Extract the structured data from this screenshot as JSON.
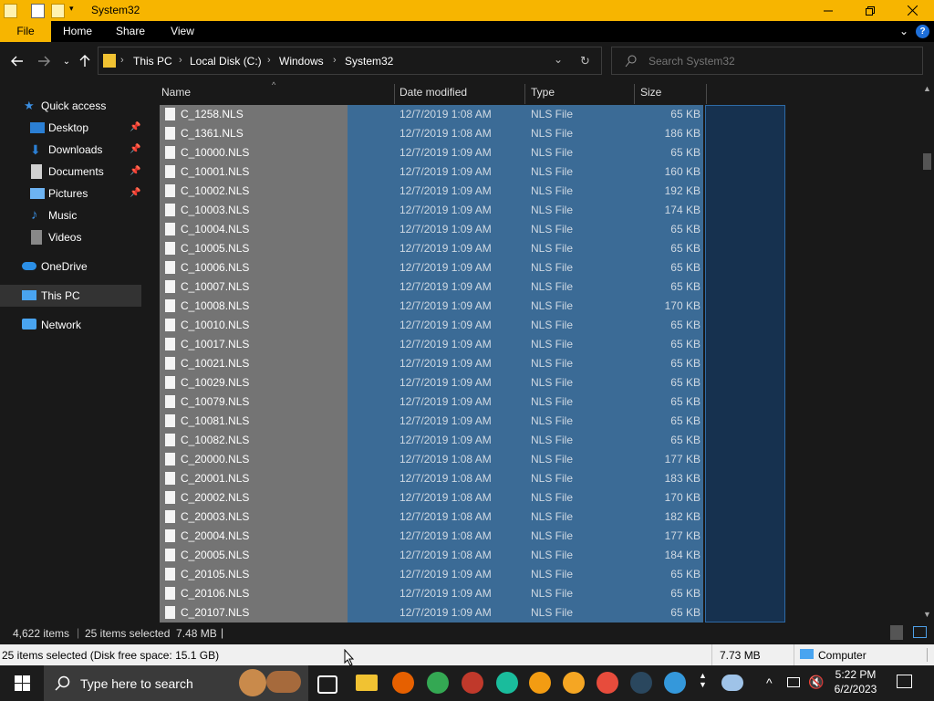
{
  "window": {
    "title": "System32",
    "minimize_icon": "minimize-icon",
    "maximize_icon": "restore-icon",
    "close_icon": "close-icon"
  },
  "ribbon": {
    "tabs": [
      "File",
      "Home",
      "Share",
      "View"
    ]
  },
  "address": {
    "crumbs": [
      "This PC",
      "Local Disk (C:)",
      "Windows",
      "System32"
    ]
  },
  "search": {
    "placeholder": "Search System32"
  },
  "nav_pane": {
    "items": [
      {
        "label": "Quick access",
        "icon": "star-icon",
        "color": "#3b8ee0",
        "pinned": false
      },
      {
        "label": "Desktop",
        "icon": "desktop-icon",
        "color": "#2b7fd4",
        "pinned": true
      },
      {
        "label": "Downloads",
        "icon": "download-icon",
        "color": "#2b7fd4",
        "pinned": true
      },
      {
        "label": "Documents",
        "icon": "document-icon",
        "color": "#cfcfcf",
        "pinned": true
      },
      {
        "label": "Pictures",
        "icon": "pictures-icon",
        "color": "#6db3f2",
        "pinned": true
      },
      {
        "label": "Music",
        "icon": "music-icon",
        "color": "#3b8ee0",
        "pinned": false
      },
      {
        "label": "Videos",
        "icon": "video-icon",
        "color": "#888888",
        "pinned": false
      },
      {
        "label": "OneDrive",
        "icon": "cloud-icon",
        "color": "#2b8fe6",
        "pinned": false
      },
      {
        "label": "This PC",
        "icon": "computer-icon",
        "color": "#49a4f0",
        "pinned": false
      },
      {
        "label": "Network",
        "icon": "network-icon",
        "color": "#49a4f0",
        "pinned": false
      }
    ]
  },
  "columns": {
    "name": "Name",
    "date": "Date modified",
    "type": "Type",
    "size": "Size"
  },
  "files": [
    {
      "name": "C_1258.NLS",
      "date": "12/7/2019 1:08 AM",
      "type": "NLS File",
      "size": "65 KB"
    },
    {
      "name": "C_1361.NLS",
      "date": "12/7/2019 1:08 AM",
      "type": "NLS File",
      "size": "186 KB"
    },
    {
      "name": "C_10000.NLS",
      "date": "12/7/2019 1:09 AM",
      "type": "NLS File",
      "size": "65 KB"
    },
    {
      "name": "C_10001.NLS",
      "date": "12/7/2019 1:09 AM",
      "type": "NLS File",
      "size": "160 KB"
    },
    {
      "name": "C_10002.NLS",
      "date": "12/7/2019 1:09 AM",
      "type": "NLS File",
      "size": "192 KB"
    },
    {
      "name": "C_10003.NLS",
      "date": "12/7/2019 1:09 AM",
      "type": "NLS File",
      "size": "174 KB"
    },
    {
      "name": "C_10004.NLS",
      "date": "12/7/2019 1:09 AM",
      "type": "NLS File",
      "size": "65 KB"
    },
    {
      "name": "C_10005.NLS",
      "date": "12/7/2019 1:09 AM",
      "type": "NLS File",
      "size": "65 KB"
    },
    {
      "name": "C_10006.NLS",
      "date": "12/7/2019 1:09 AM",
      "type": "NLS File",
      "size": "65 KB"
    },
    {
      "name": "C_10007.NLS",
      "date": "12/7/2019 1:09 AM",
      "type": "NLS File",
      "size": "65 KB"
    },
    {
      "name": "C_10008.NLS",
      "date": "12/7/2019 1:09 AM",
      "type": "NLS File",
      "size": "170 KB"
    },
    {
      "name": "C_10010.NLS",
      "date": "12/7/2019 1:09 AM",
      "type": "NLS File",
      "size": "65 KB"
    },
    {
      "name": "C_10017.NLS",
      "date": "12/7/2019 1:09 AM",
      "type": "NLS File",
      "size": "65 KB"
    },
    {
      "name": "C_10021.NLS",
      "date": "12/7/2019 1:09 AM",
      "type": "NLS File",
      "size": "65 KB"
    },
    {
      "name": "C_10029.NLS",
      "date": "12/7/2019 1:09 AM",
      "type": "NLS File",
      "size": "65 KB"
    },
    {
      "name": "C_10079.NLS",
      "date": "12/7/2019 1:09 AM",
      "type": "NLS File",
      "size": "65 KB"
    },
    {
      "name": "C_10081.NLS",
      "date": "12/7/2019 1:09 AM",
      "type": "NLS File",
      "size": "65 KB"
    },
    {
      "name": "C_10082.NLS",
      "date": "12/7/2019 1:09 AM",
      "type": "NLS File",
      "size": "65 KB"
    },
    {
      "name": "C_20000.NLS",
      "date": "12/7/2019 1:08 AM",
      "type": "NLS File",
      "size": "177 KB"
    },
    {
      "name": "C_20001.NLS",
      "date": "12/7/2019 1:08 AM",
      "type": "NLS File",
      "size": "183 KB"
    },
    {
      "name": "C_20002.NLS",
      "date": "12/7/2019 1:08 AM",
      "type": "NLS File",
      "size": "170 KB"
    },
    {
      "name": "C_20003.NLS",
      "date": "12/7/2019 1:08 AM",
      "type": "NLS File",
      "size": "182 KB"
    },
    {
      "name": "C_20004.NLS",
      "date": "12/7/2019 1:08 AM",
      "type": "NLS File",
      "size": "177 KB"
    },
    {
      "name": "C_20005.NLS",
      "date": "12/7/2019 1:08 AM",
      "type": "NLS File",
      "size": "184 KB"
    },
    {
      "name": "C_20105.NLS",
      "date": "12/7/2019 1:09 AM",
      "type": "NLS File",
      "size": "65 KB"
    },
    {
      "name": "C_20106.NLS",
      "date": "12/7/2019 1:09 AM",
      "type": "NLS File",
      "size": "65 KB"
    },
    {
      "name": "C_20107.NLS",
      "date": "12/7/2019 1:09 AM",
      "type": "NLS File",
      "size": "65 KB"
    }
  ],
  "status": {
    "item_count": "4,622 items",
    "selection": "25 items selected  7.48 MB"
  },
  "infobar": {
    "left": "25 items selected (Disk free space: 15.1 GB)",
    "size": "7.73 MB",
    "location": "Computer"
  },
  "taskbar": {
    "search_placeholder": "Type here to search",
    "time": "5:22 PM",
    "date": "6/2/2023",
    "apps": [
      {
        "name": "task-view-icon",
        "color": "#1c1c1c"
      },
      {
        "name": "file-explorer-icon",
        "color": "#f1c232"
      },
      {
        "name": "firefox-icon",
        "color": "#e66000"
      },
      {
        "name": "chrome-icon",
        "color": "#34a853"
      },
      {
        "name": "app-robot-icon",
        "color": "#c0392b"
      },
      {
        "name": "opera-gx-icon",
        "color": "#1abc9c"
      },
      {
        "name": "app-orange-icon",
        "color": "#f39c12"
      },
      {
        "name": "brave-icon",
        "color": "#f5a623"
      },
      {
        "name": "app-red-icon",
        "color": "#e74c3c"
      },
      {
        "name": "steam-icon",
        "color": "#2a475e"
      },
      {
        "name": "app-blue-icon",
        "color": "#3498db"
      }
    ]
  }
}
